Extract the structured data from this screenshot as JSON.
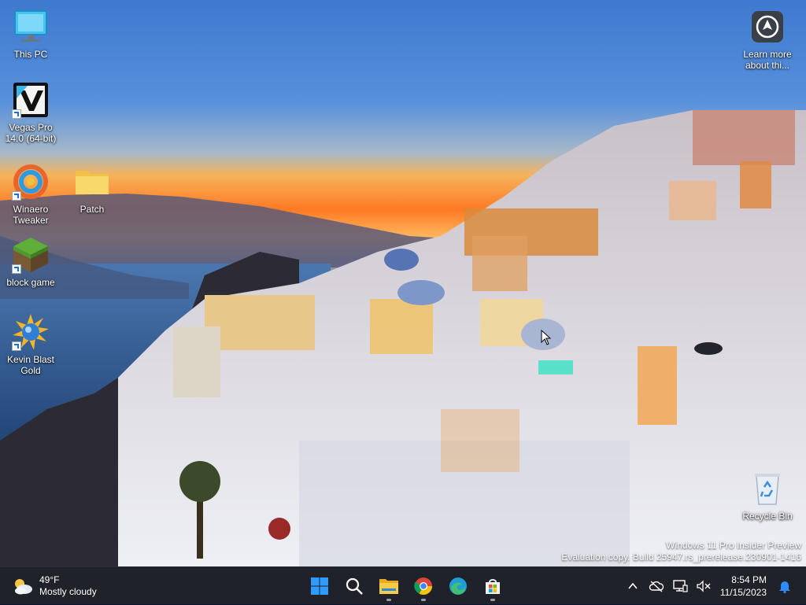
{
  "desktop": {
    "icons": [
      {
        "label": "This PC",
        "icon": "computer-icon"
      },
      {
        "label": "Vegas Pro 14.0 (64-bit)",
        "icon": "vegas-icon"
      },
      {
        "label": "Winaero Tweaker",
        "icon": "winaero-icon"
      },
      {
        "label": "Patch",
        "icon": "folder-icon"
      },
      {
        "label": "block game",
        "icon": "block-game-icon"
      },
      {
        "label": "Kevin Blast Gold",
        "icon": "kevin-blast-icon"
      },
      {
        "label": "Learn more about thi...",
        "icon": "learn-more-icon"
      },
      {
        "label": "Recycle Bin",
        "icon": "recycle-bin-icon"
      }
    ]
  },
  "watermark": {
    "line1": "Windows 11 Pro Insider Preview",
    "line2": "Evaluation copy. Build 25947.rs_prerelease.230901-1416"
  },
  "taskbar": {
    "weather": {
      "temp": "49°F",
      "condition": "Mostly cloudy",
      "icon": "partly-cloudy-icon"
    },
    "apps": [
      {
        "name": "Start",
        "icon": "windows-start-icon"
      },
      {
        "name": "Search",
        "icon": "search-icon"
      },
      {
        "name": "File Explorer",
        "icon": "file-explorer-icon"
      },
      {
        "name": "Google Chrome",
        "icon": "chrome-icon"
      },
      {
        "name": "Microsoft Edge",
        "icon": "edge-icon"
      },
      {
        "name": "Microsoft Store",
        "icon": "store-icon"
      }
    ],
    "tray": {
      "time": "8:54 PM",
      "date": "11/15/2023"
    }
  },
  "colors": {
    "taskbar_bg": "#1f2228",
    "accent": "#2f8cff"
  }
}
